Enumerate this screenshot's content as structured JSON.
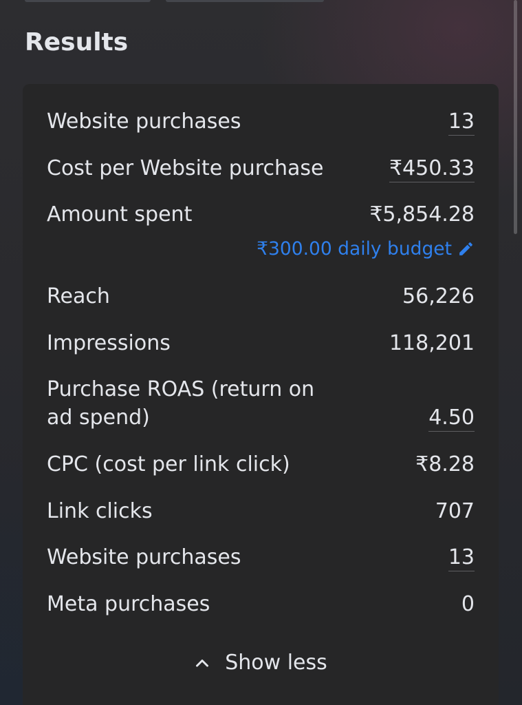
{
  "section": {
    "title": "Results"
  },
  "metrics": [
    {
      "label": "Website purchases",
      "value": "13"
    },
    {
      "label": "Cost per Website purchase",
      "value": "₹450.33"
    },
    {
      "label": "Amount spent",
      "value": "₹5,854.28"
    },
    {
      "label": "Reach",
      "value": "56,226"
    },
    {
      "label": "Impressions",
      "value": "118,201"
    },
    {
      "label": "Purchase ROAS (return on ad spend)",
      "value": "4.50"
    },
    {
      "label": "CPC (cost per link click)",
      "value": "₹8.28"
    },
    {
      "label": "Link clicks",
      "value": "707"
    },
    {
      "label": "Website purchases",
      "value": "13"
    },
    {
      "label": "Meta purchases",
      "value": "0"
    }
  ],
  "budget": {
    "text": "₹300.00 daily budget",
    "icon": "pencil-icon"
  },
  "toggle": {
    "label": "Show less",
    "icon": "chevron-up-icon"
  },
  "colors": {
    "text": "#e4e6eb",
    "link": "#2f80ed",
    "card": "#262627"
  }
}
